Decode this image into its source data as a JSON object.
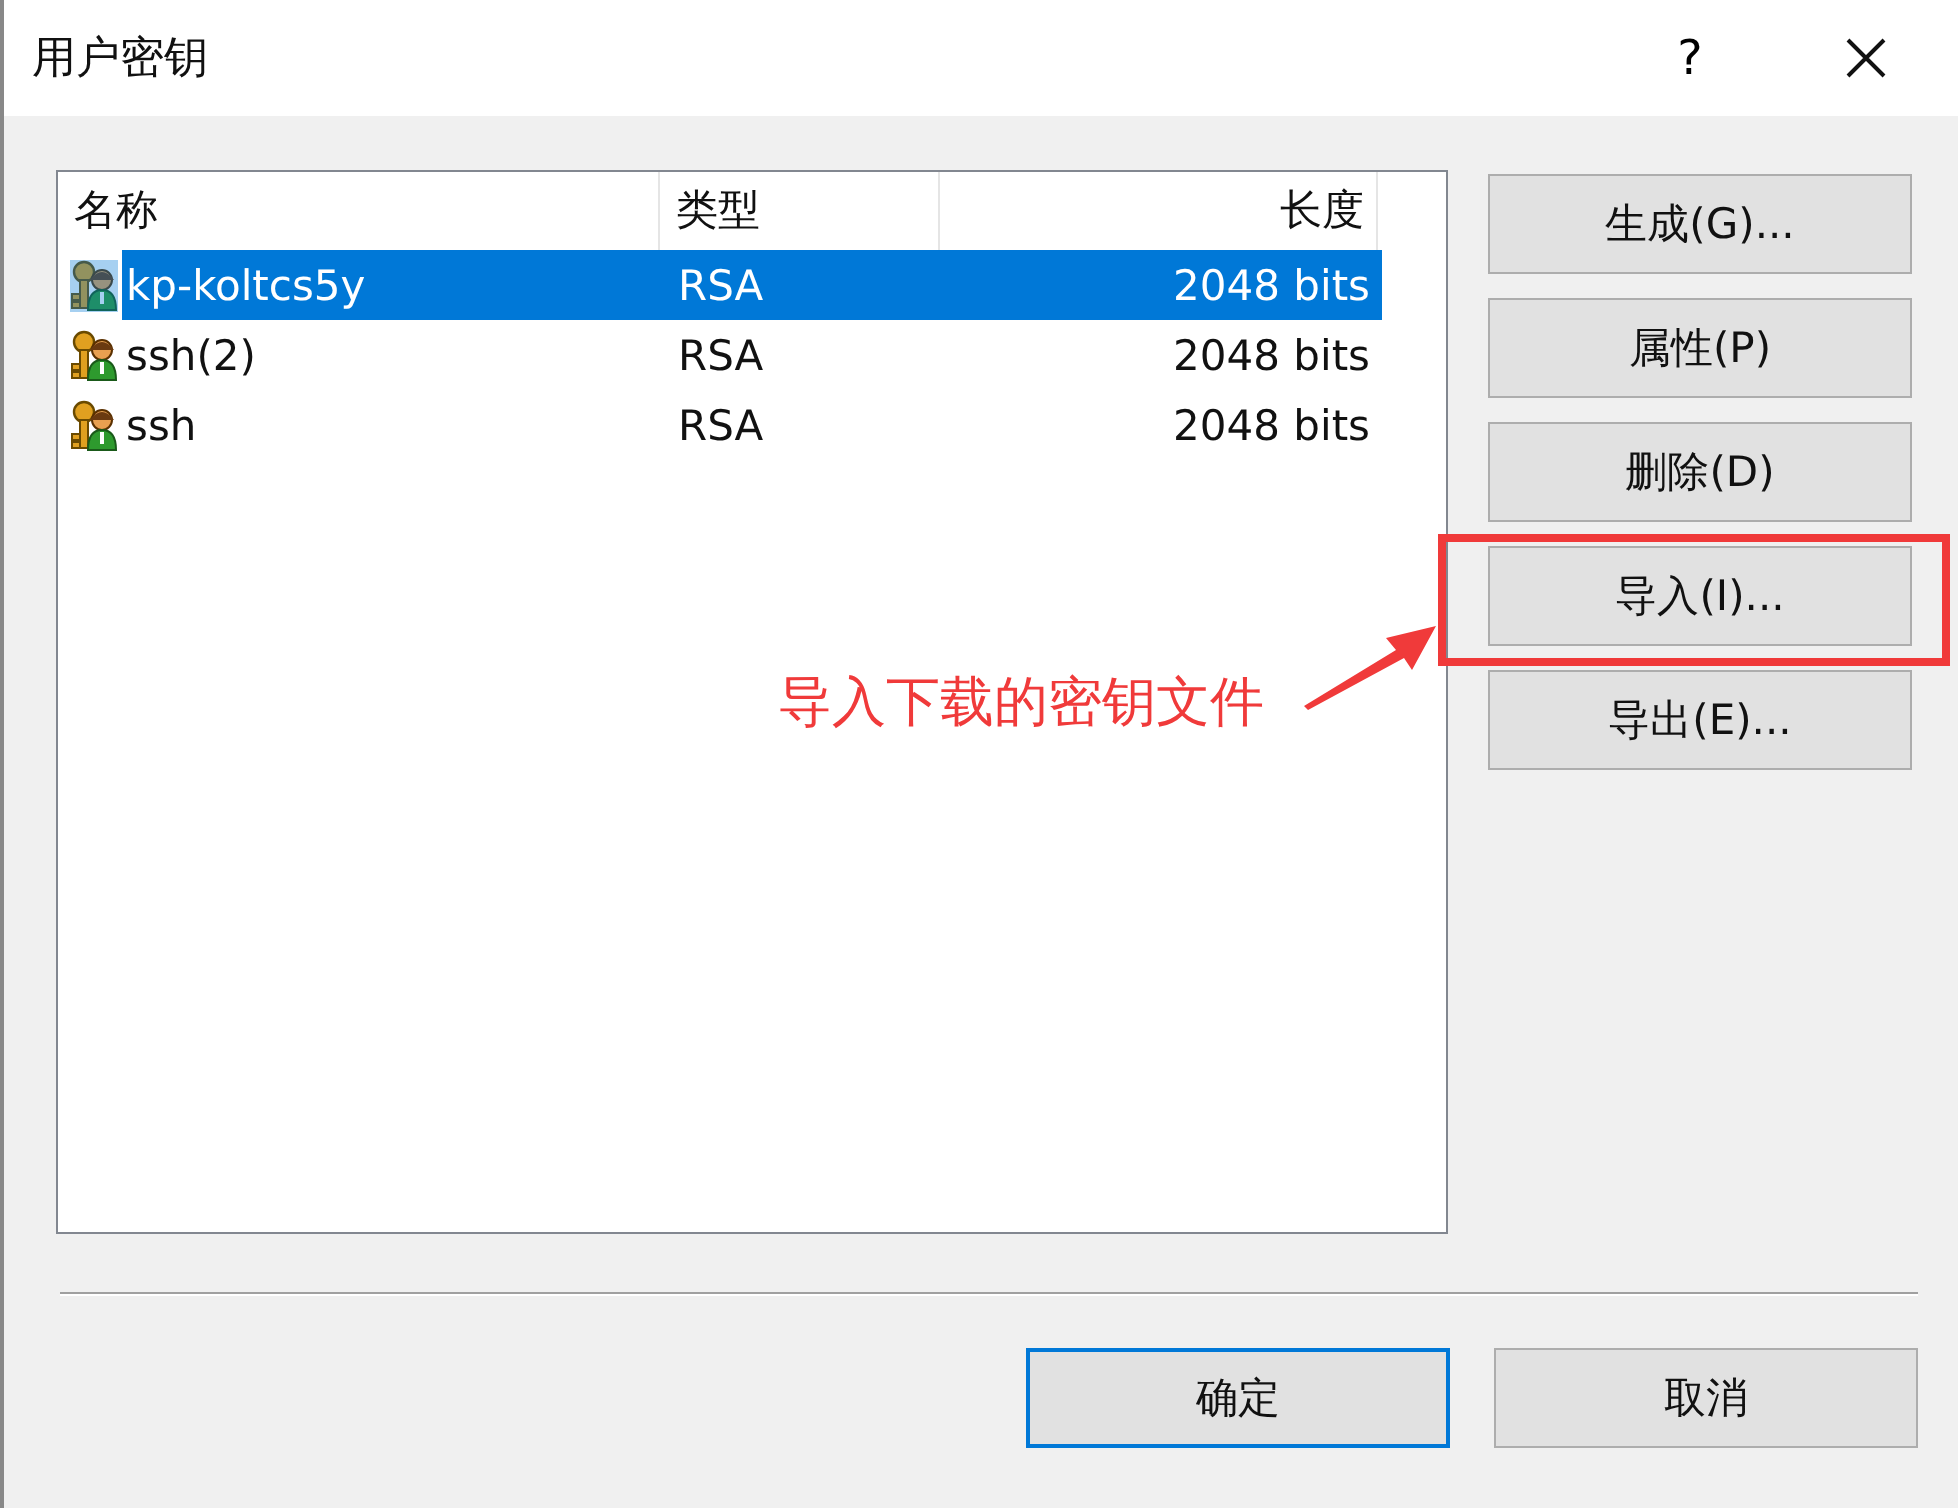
{
  "window": {
    "title": "用户密钥",
    "help": "?"
  },
  "list": {
    "columns": [
      "名称",
      "类型",
      "长度"
    ],
    "rows": [
      {
        "name": "kp-koltcs5y",
        "type": "RSA",
        "length": "2048 bits",
        "selected": true
      },
      {
        "name": "ssh(2)",
        "type": "RSA",
        "length": "2048 bits",
        "selected": false
      },
      {
        "name": "ssh",
        "type": "RSA",
        "length": "2048 bits",
        "selected": false
      }
    ]
  },
  "side_buttons": [
    {
      "label": "生成(G)...",
      "highlighted": false
    },
    {
      "label": "属性(P)",
      "highlighted": false
    },
    {
      "label": "删除(D)",
      "highlighted": false
    },
    {
      "label": "导入(I)...",
      "highlighted": true
    },
    {
      "label": "导出(E)...",
      "highlighted": false
    }
  ],
  "annotation": {
    "text": "导入下载的密钥文件"
  },
  "dialog_buttons": [
    {
      "label": "确定",
      "default": true
    },
    {
      "label": "取消",
      "default": false
    }
  ]
}
